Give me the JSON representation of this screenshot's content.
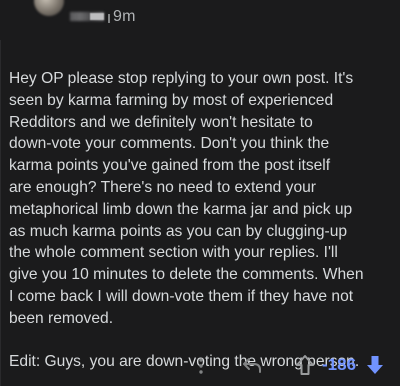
{
  "comment": {
    "time": "9m",
    "body_main": "Hey OP please stop replying to your own post. It's\nseen by karma farming by most of experienced\nRedditors and we definitely won't hesitate to\ndown-vote your comments. Don't you think the\nkarma points you've gained from the post itself\nare enough? There's no need to extend your\nmetaphorical limb down the karma jar and pick up\nas much karma points as you can by clugging-up\nthe whole comment section with your replies. I'll\ngive you 10 minutes to delete the comments. When\nI come back I will down-vote them if they have not\nbeen removed.",
    "body_edit": "Edit: Guys, you are down-voting the wrong person."
  },
  "actions": {
    "more_icon": "vertical-ellipsis",
    "reply_icon": "reply-arrow",
    "upvote_icon": "upvote-arrow-outline",
    "score": "-186",
    "downvote_icon": "downvote-arrow-filled"
  },
  "colors": {
    "background": "#1b1b1c",
    "text": "#d7dadc",
    "muted": "#818384",
    "downvote": "#7193ff"
  }
}
